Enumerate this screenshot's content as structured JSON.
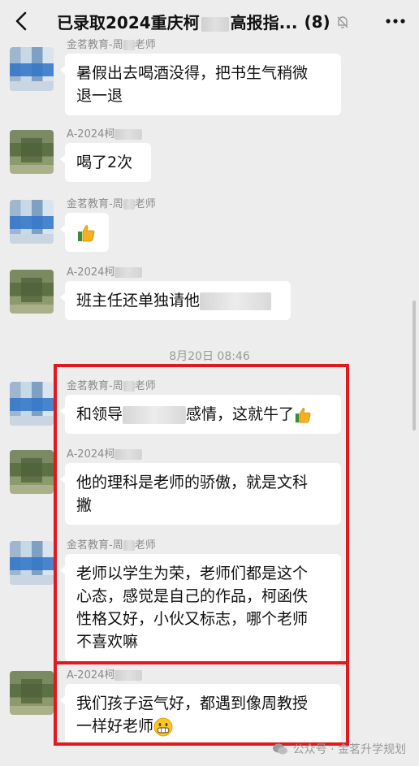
{
  "header": {
    "title_part1": "已录取2024重庆柯",
    "title_part2": "高报指...",
    "count": "(8)",
    "back_icon": "chevron-left-icon",
    "mute_icon": "bell-off-icon",
    "more_icon": "more-dots-icon"
  },
  "messages": [
    {
      "sender_prefix": "金茗教育-周",
      "sender_suffix": "老师",
      "line1": "暑假出去喝酒没得，把书生气稍微",
      "line2": "退一退"
    },
    {
      "sender_prefix": "A-2024柯",
      "text": "喝了2次"
    },
    {
      "sender_prefix": "金茗教育-周",
      "sender_suffix": "老师",
      "emoji": "thumbs-up-icon"
    },
    {
      "sender_prefix": "A-2024柯",
      "text_prefix": "班主任还单独请他"
    },
    {
      "sender_prefix": "金茗教育-周",
      "sender_suffix": "老师",
      "text_prefix": "和领导",
      "text_suffix": "感情，这就牛了",
      "emoji": "thumbs-up-icon"
    },
    {
      "sender_prefix": "A-2024柯",
      "line1": "他的理科是老师的骄傲，就是文科",
      "line2": "撇"
    },
    {
      "sender_prefix": "金茗教育-周",
      "sender_suffix": "老师",
      "line1": "老师以学生为荣，老师们都是这个",
      "line2": "心态，感觉是自己的作品，柯函佚",
      "line3": "性格又好，小伙又标志，哪个老师",
      "line4": "不喜欢嘛"
    },
    {
      "sender_prefix": "A-2024柯",
      "line1": "我们孩子运气好，都遇到像周教授",
      "line2": "一样好老师",
      "emoji": "grinning-face-icon"
    }
  ],
  "time_separator": "8月20日 08:46",
  "watermark": "公众号 · 金茗升学规划",
  "colors": {
    "highlight": "#e0191e",
    "bubble": "#ffffff",
    "background": "#ededed"
  }
}
